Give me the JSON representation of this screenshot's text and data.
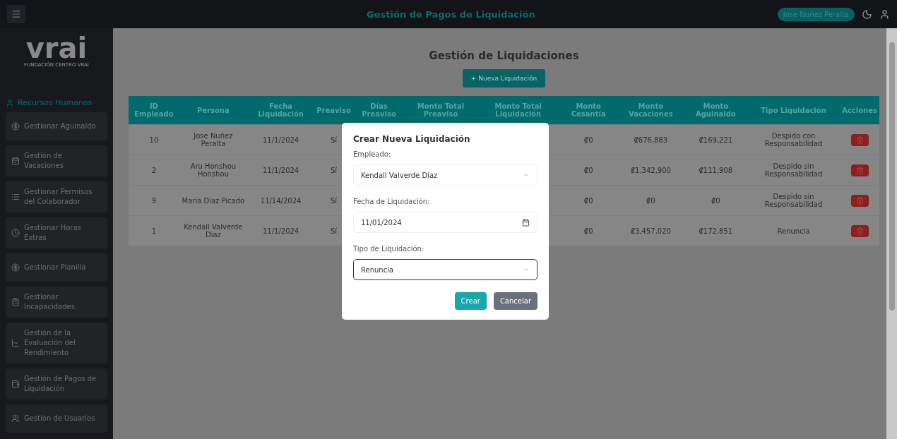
{
  "top_bar": {
    "title": "Gestión de Pagos de Liquidación",
    "user": "Jose Nuñez Peralta"
  },
  "logo": {
    "name": "vrai",
    "subtitle": "FUNDACIÓN CENTRO VRAI"
  },
  "sidebar": {
    "section": "Recursos Humanos",
    "items": [
      {
        "label": "Gestionar Aguinaldo"
      },
      {
        "label": "Gestión de Vacaciones"
      },
      {
        "label": "Gestionar Permisos del Colaborador"
      },
      {
        "label": "Gestionar Horas Extras"
      },
      {
        "label": "Gestionar Planilla"
      },
      {
        "label": "Gestionar Incapacidades"
      },
      {
        "label": "Gestión de la Evaluación del Rendimiento"
      },
      {
        "label": "Gestión de Pagos de Liquidación"
      },
      {
        "label": "Gestión de Usuarios"
      }
    ]
  },
  "page": {
    "title": "Gestión de Liquidaciones",
    "new_button": "+ Nueva Liquidación"
  },
  "table": {
    "columns": [
      "ID Empleado",
      "Persona",
      "Fecha Liquidación",
      "Preaviso",
      "Días Preaviso",
      "Monto Total Preaviso",
      "Monto Total Liquidación",
      "Monto Cesantía",
      "Monto Vacaciones",
      "Monto Aguinaldo",
      "Tipo Liquidación",
      "Acciones"
    ],
    "rows": [
      {
        "id": "10",
        "persona": "Jose Nuñez Peralta",
        "fecha": "11/1/2024",
        "preaviso": "Sí",
        "cesantia": "₡0",
        "vacaciones": "₡676,883",
        "aguinaldo": "₡169,221",
        "tipo": "Despido con Responsabilidad"
      },
      {
        "id": "2",
        "persona": "Aru Honshou Honshou",
        "fecha": "11/1/2024",
        "preaviso": "Sí",
        "cesantia": "₡0",
        "vacaciones": "₡1,342,900",
        "aguinaldo": "₡111,908",
        "tipo": "Despido sin Responsabilidad"
      },
      {
        "id": "9",
        "persona": "Maria Diaz Picado",
        "fecha": "11/14/2024",
        "preaviso": "Sí",
        "cesantia": "₡0",
        "vacaciones": "₡0",
        "aguinaldo": "₡0",
        "tipo": "Despido sin Responsabilidad"
      },
      {
        "id": "1",
        "persona": "Kendall Valverde Diaz",
        "fecha": "11/1/2024",
        "preaviso": "Sí",
        "cesantia": "₡0",
        "vacaciones": "₡3,457,020",
        "aguinaldo": "₡172,851",
        "tipo": "Renuncia"
      }
    ]
  },
  "modal": {
    "title": "Crear Nueva Liquidación",
    "fields": [
      {
        "kind": "select",
        "label": "Empleado:",
        "value": "Kendall Valverde Diaz",
        "focused": false
      },
      {
        "kind": "date",
        "label": "Fecha de Liquidación:",
        "value": "11/01/2024",
        "focused": false
      },
      {
        "kind": "select",
        "label": "Tipo de Liquidación:",
        "value": "Renuncia",
        "focused": true
      }
    ],
    "buttons": [
      {
        "kind": "primary",
        "label": "Crear"
      },
      {
        "kind": "secondary",
        "label": "Cancelar"
      }
    ]
  }
}
